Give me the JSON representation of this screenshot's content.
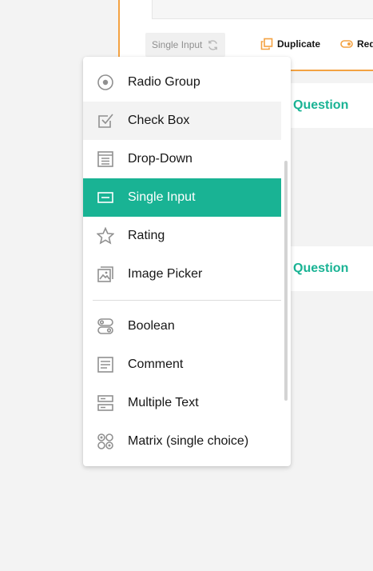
{
  "question": {
    "type_chip_label": "Single Input",
    "actions": {
      "duplicate": "Duplicate",
      "required": "Req"
    },
    "strip_label": "Question",
    "strip_label_2": "Question"
  },
  "menu": {
    "items": [
      {
        "label": "Radio Group",
        "icon": "radio-group-icon",
        "state": "normal"
      },
      {
        "label": "Check Box",
        "icon": "checkbox-icon",
        "state": "hover"
      },
      {
        "label": "Drop-Down",
        "icon": "dropdown-icon",
        "state": "normal"
      },
      {
        "label": "Single Input",
        "icon": "single-input-icon",
        "state": "selected"
      },
      {
        "label": "Rating",
        "icon": "star-icon",
        "state": "normal"
      },
      {
        "label": "Image Picker",
        "icon": "image-picker-icon",
        "state": "normal"
      },
      {
        "label": "Boolean",
        "icon": "boolean-icon",
        "state": "normal"
      },
      {
        "label": "Comment",
        "icon": "comment-icon",
        "state": "normal"
      },
      {
        "label": "Multiple Text",
        "icon": "multiple-text-icon",
        "state": "normal"
      },
      {
        "label": "Matrix (single choice)",
        "icon": "matrix-icon",
        "state": "normal"
      }
    ]
  },
  "colors": {
    "accent": "#19b394",
    "selected_border": "#f3a242",
    "icon": "#909090"
  }
}
